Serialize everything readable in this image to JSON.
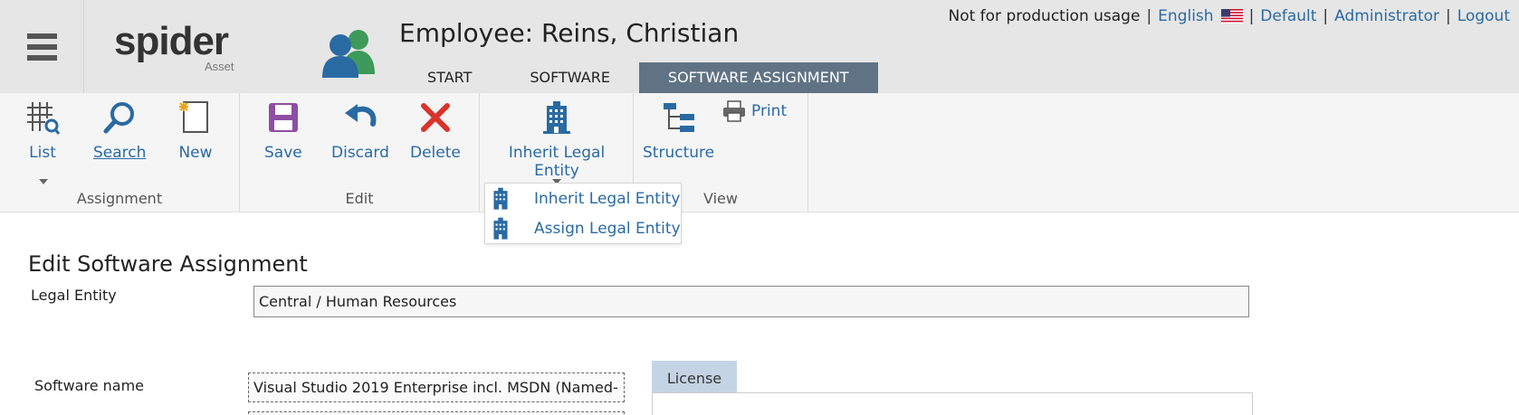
{
  "header": {
    "title": "Employee: Reins, Christian",
    "logo_text": "spider",
    "logo_subtext": "Asset",
    "topbar": {
      "notice": "Not for production usage",
      "language": "English",
      "profile": "Default",
      "user": "Administrator",
      "logout": "Logout"
    },
    "tabs": [
      {
        "label": "START",
        "active": false
      },
      {
        "label": "SOFTWARE",
        "active": false
      },
      {
        "label": "SOFTWARE ASSIGNMENT",
        "active": true
      }
    ]
  },
  "ribbon": {
    "groups": {
      "assignment": "Assignment",
      "edit": "Edit",
      "legal": "",
      "view": "View"
    },
    "buttons": {
      "list": "List",
      "search": "Search",
      "new": "New",
      "save": "Save",
      "discard": "Discard",
      "delete": "Delete",
      "inherit_legal_entity": "Inherit Legal Entity",
      "structure": "Structure",
      "print": "Print"
    },
    "dropdown": {
      "items": [
        {
          "label": "Inherit Legal Entity",
          "icon": "building-icon"
        },
        {
          "label": "Assign Legal Entity",
          "icon": "building-icon"
        }
      ]
    }
  },
  "form": {
    "title": "Edit Software Assignment",
    "legal_entity_label": "Legal Entity",
    "legal_entity_value": "Central / Human Resources",
    "software_name_label": "Software name",
    "software_name_value": "Visual Studio 2019 Enterprise incl. MSDN (Named-",
    "license_tab": "License"
  },
  "colors": {
    "accent": "#2a6aa3",
    "active_tab": "#607384",
    "header_bg": "#e6e6e6",
    "ribbon_bg": "#f5f5f5",
    "delete_red": "#d9342b",
    "save_purple": "#8e4ea3",
    "license_tab_bg": "#c5d4e4"
  }
}
